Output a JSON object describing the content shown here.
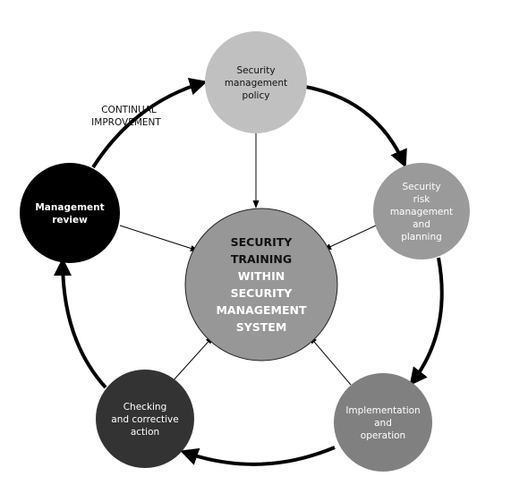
{
  "center": {
    "lines": [
      "SECURITY",
      "TRAINING",
      "WITHIN",
      "SECURITY",
      "MANAGEMENT",
      "SYSTEM"
    ],
    "line_colors": [
      "#111111",
      "#111111",
      "#ffffff",
      "#ffffff",
      "#ffffff",
      "#ffffff"
    ],
    "fill": "#979797"
  },
  "nodes": [
    {
      "id": "policy",
      "lines": [
        "Security",
        "management",
        "policy"
      ],
      "fill": "#c0c0c0",
      "text_color": "#111111"
    },
    {
      "id": "risk",
      "lines": [
        "Security",
        "risk",
        "management",
        "and",
        "planning"
      ],
      "fill": "#9a9a9a",
      "text_color": "#ffffff"
    },
    {
      "id": "implementation",
      "lines": [
        "Implementation",
        "and",
        "operation"
      ],
      "fill": "#808080",
      "text_color": "#ffffff"
    },
    {
      "id": "checking",
      "lines": [
        "Checking",
        "and corrective",
        "action"
      ],
      "fill": "#333333",
      "text_color": "#ffffff"
    },
    {
      "id": "review",
      "lines": [
        "Management",
        "review"
      ],
      "fill": "#000000",
      "text_color": "#ffffff"
    }
  ],
  "cycle_label": [
    "CONTINUAL",
    "IMPROVEMENT"
  ]
}
